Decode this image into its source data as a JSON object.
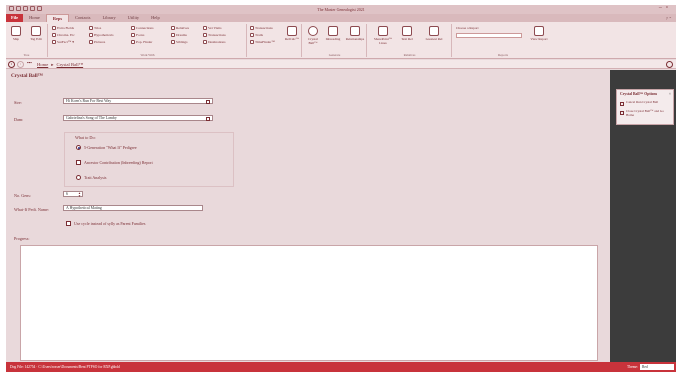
{
  "window": {
    "title": "The Master Genealogist 2021"
  },
  "menu": {
    "tabs": [
      "File",
      "Home",
      "Reps",
      "Contacts",
      "Library",
      "Utility",
      "Help"
    ],
    "help_icons": "? ⌃"
  },
  "ribbon": {
    "groups": {
      "g1": "Tree",
      "g2": "Work With",
      "g3": "Generate",
      "g4": "Relatives",
      "g5": "Reports"
    },
    "big": {
      "navigation": "Ship",
      "tree_edit": "Tag Edit",
      "rel_calc": "RelCalc™",
      "crystal": "Crystal Ball™",
      "inbreeding": "Inbreeding",
      "relationships": "Relationships",
      "sharepoint": "SharePoint™ Lines",
      "text_rel": "Text Rel",
      "greatest_rel": "Greatest Rel",
      "genealogy": "Genealogy",
      "view_report": "View Report"
    },
    "small": {
      "r1": "Extra Fields",
      "r2": "Chroma. Etc",
      "r3": "SurFact™ ▾",
      "r4": "Trios",
      "r5": "Hypotheticals",
      "r6": "Pictures",
      "r7": "Connections",
      "r8": "Focus",
      "r9": "Pop. Finder",
      "r10": "Relatives",
      "r11": "Dreams",
      "r12": "Siblings",
      "r13": "Vet Visits",
      "r14": "Transactions",
      "r15": "Destinations",
      "r16": "Transactions",
      "r17": "Trails",
      "r18": "TimeFinder™"
    },
    "report_label": "Choose a Report"
  },
  "nav": {
    "dots": "•••",
    "home": "Home",
    "sep": "▸",
    "current": "Crystal Ball™"
  },
  "page": {
    "title": "Crystal Ball™",
    "sire_label": "Sire:",
    "sire_value": "Hi Koen's Run For Best Way",
    "dam_label": "Dam:",
    "dam_value": "Gabrielina's Song of The Lamby",
    "todo_label": "What to Do:",
    "options": [
      "5-Generation \"What If\" Pedigree",
      "Ancestor Contribution (Inbreeding) Report",
      "Trait Analysis"
    ],
    "gens_label": "No. Gens:",
    "gens_value": "6",
    "name_label": "What-If Pedi. Name:",
    "name_value": "A Hypothetical Mating",
    "use_cycle_label": "Use cycle instead of sylly as Parent Families",
    "progress_label": "Progress:"
  },
  "side": {
    "title": "Crystal Ball™ Options",
    "close": "×",
    "items": [
      "Cancel Run Crystal Ball",
      "Close Crystal Ball™ and Go Home"
    ]
  },
  "status": {
    "left": "Dog File: 142754 · C:\\Users\\rosser\\Documents\\Bent PTPSO for RXP.gbhdd",
    "theme_label": "Theme:",
    "theme_value": "Red"
  }
}
